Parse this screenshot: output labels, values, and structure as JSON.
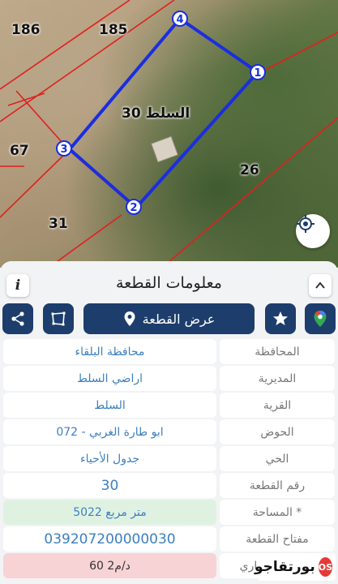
{
  "map": {
    "parcel_labels": [
      "186",
      "185",
      "67",
      "31",
      "26"
    ],
    "plot_label": "السلط  30",
    "vertices": [
      "1",
      "2",
      "3",
      "4"
    ],
    "location_button_icon": "crosshair-icon"
  },
  "sheet": {
    "title": "معلومات القطعة",
    "info_icon": "i",
    "collapse_icon": "chevron-up-icon"
  },
  "toolbar": {
    "show_plot_label": "عرض القطعة",
    "show_plot_icon": "map-pin-icon",
    "share_icon": "share-icon",
    "polygon_icon": "polygon-icon",
    "star_icon": "star-icon",
    "maps_icon": "google-maps-icon"
  },
  "fields": [
    {
      "label": "المحافظة",
      "value": "محافظة البلقاء"
    },
    {
      "label": "المديرية",
      "value": "اراضي السلط"
    },
    {
      "label": "القرية",
      "value": "السلط"
    },
    {
      "label": "الحوض",
      "value": "ابو طارة الغربي - 072"
    },
    {
      "label": "الحي",
      "value": "جدول الأحياء"
    },
    {
      "label": "رقم القطعة",
      "value": "30"
    },
    {
      "label": "المساحة *",
      "value": "5022  متر مربع"
    },
    {
      "label": "مفتاح القطعة",
      "value": "039207200000030"
    },
    {
      "label": "الأسعار الإيجاري",
      "value": "60 د/م2"
    }
  ],
  "watermark": {
    "text": "بورتقاجو",
    "mark": "OS"
  },
  "colors": {
    "primary": "#1d3d6c",
    "value_text": "#3c7fc1",
    "plot_outline": "#1a2ee0",
    "area_bg": "#dff2e2",
    "price_bg": "#f8d3d6"
  }
}
